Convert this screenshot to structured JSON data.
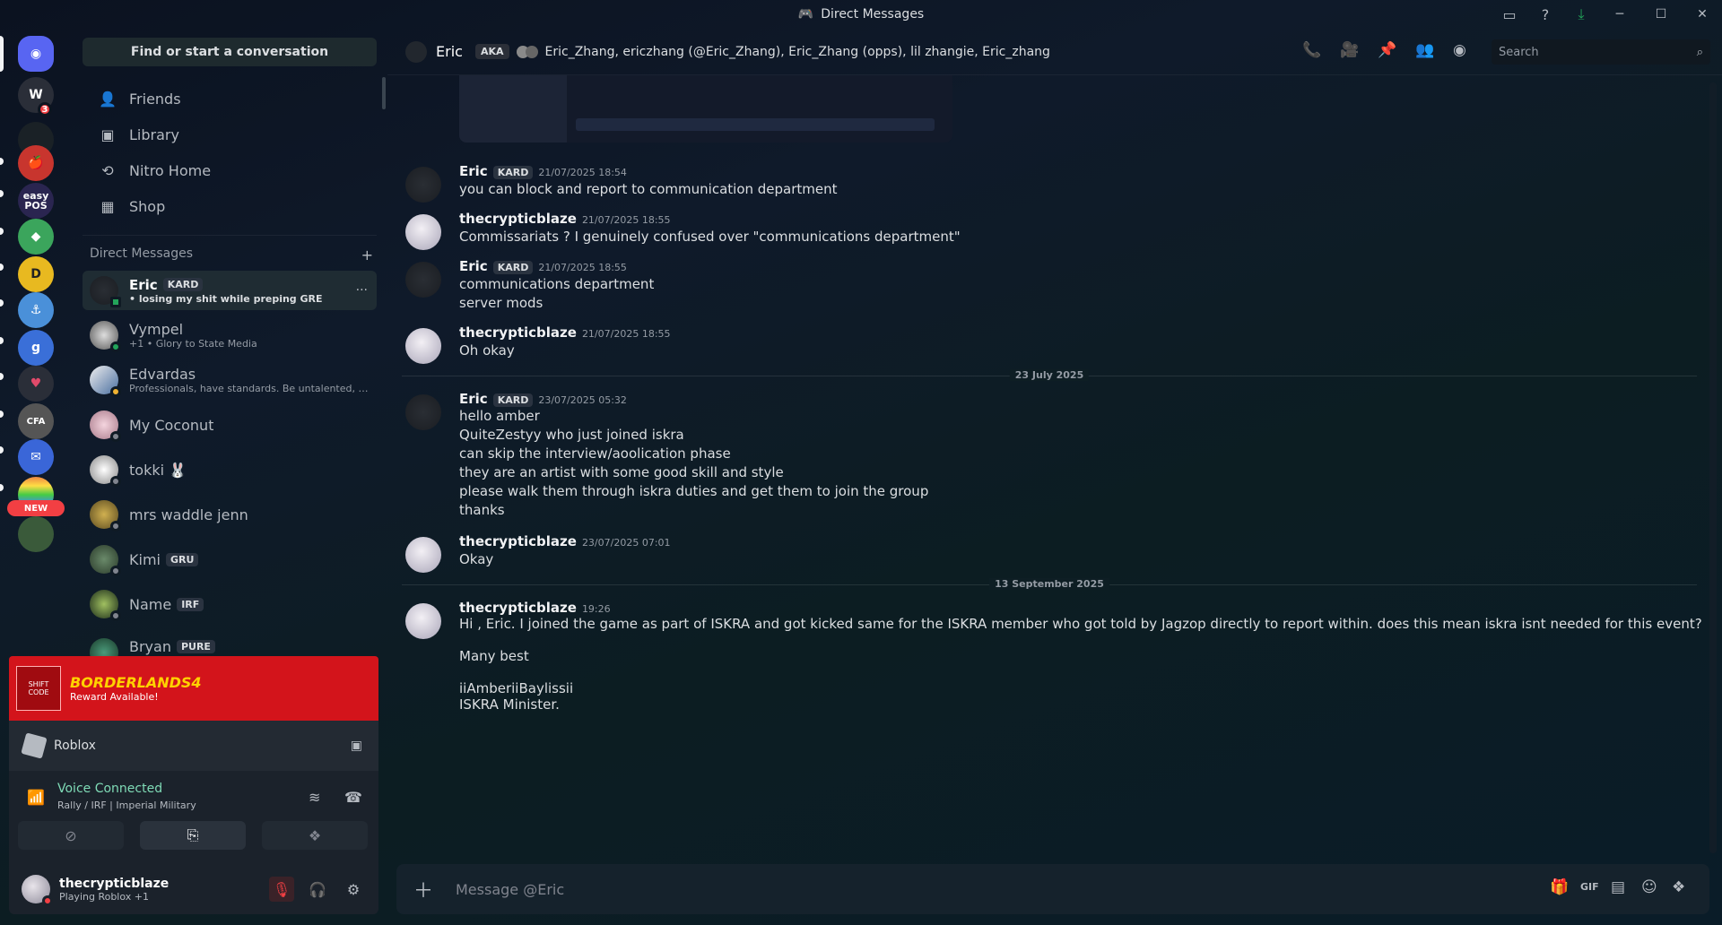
{
  "window": {
    "title": "Direct Messages"
  },
  "sidebar": {
    "find_label": "Find or start a conversation",
    "nav": [
      {
        "label": "Friends",
        "icon": "friends-icon"
      },
      {
        "label": "Library",
        "icon": "library-icon"
      },
      {
        "label": "Nitro Home",
        "icon": "nitro-icon"
      },
      {
        "label": "Shop",
        "icon": "shop-icon"
      }
    ],
    "dm_header": "Direct Messages",
    "dms": [
      {
        "name": "Eric",
        "tag": "KARD",
        "sub": "• losing my shit while preping GRE"
      },
      {
        "name": "Vympel",
        "tag": "",
        "sub": "+1 • Glory to State Media"
      },
      {
        "name": "Edvardas",
        "tag": "",
        "sub": "Professionals, have standards. Be untalented, be l..."
      },
      {
        "name": "My Coconut",
        "tag": "",
        "sub": ""
      },
      {
        "name": "tokki 🐰",
        "tag": "",
        "sub": ""
      },
      {
        "name": "mrs waddle jenn",
        "tag": "",
        "sub": ""
      },
      {
        "name": "Kimi",
        "tag": "GRU",
        "sub": ""
      },
      {
        "name": "Name",
        "tag": "IRF",
        "sub": ""
      },
      {
        "name": "Bryan",
        "tag": "PURE",
        "sub": ""
      }
    ],
    "promo": {
      "title": "BORDERLANDS4",
      "sub": "Reward Available!",
      "logo_text": "SHIFT CODE"
    },
    "activity": {
      "game": "Roblox"
    },
    "voice": {
      "title": "Voice Connected",
      "sub": "Rally / IRF | Imperial Military"
    },
    "user": {
      "name": "thecrypticblaze",
      "status": "Playing Roblox +1"
    }
  },
  "rail": {
    "badge_count": "3",
    "new_label": "NEW",
    "pos_label": "easy POS"
  },
  "chat": {
    "header": {
      "name": "Eric",
      "aka": "AKA",
      "aliases": "Eric_Zhang, ericzhang (@Eric_Zhang), Eric_Zhang (opps), lil zhangie, Eric_zhang",
      "search_placeholder": "Search"
    },
    "messages": [
      {
        "author": "Eric",
        "tag": "KARD",
        "ts": "21/07/2025 18:54",
        "lines": [
          "you can block and report to communication department"
        ]
      },
      {
        "author": "thecrypticblaze",
        "tag": "",
        "ts": "21/07/2025 18:55",
        "lines": [
          "Commissariats ?  I genuinely confused over \"communications department\""
        ]
      },
      {
        "author": "Eric",
        "tag": "KARD",
        "ts": "21/07/2025 18:55",
        "lines": [
          "communications department",
          "server mods"
        ]
      },
      {
        "author": "thecrypticblaze",
        "tag": "",
        "ts": "21/07/2025 18:55",
        "lines": [
          "Oh okay"
        ]
      },
      {
        "author": "Eric",
        "tag": "KARD",
        "ts": "23/07/2025 05:32",
        "lines": [
          "hello amber",
          "QuiteZestyy who just joined iskra",
          "can skip the interview/aoolication phase",
          "they are an artist with some good skill and style",
          "please walk them through iskra duties and get them to join the group",
          "thanks"
        ]
      },
      {
        "author": "thecrypticblaze",
        "tag": "",
        "ts": "23/07/2025 07:01",
        "lines": [
          "Okay"
        ]
      },
      {
        "author": "thecrypticblaze",
        "tag": "",
        "ts": "19:26",
        "lines": [
          "Hi , Eric. I joined the game as part of ISKRA and got kicked same for the ISKRA member who got told by Jagzop directly to report within. does this mean iskra isnt needed for this event?",
          "",
          "Many best",
          "",
          "iiAmberiiBaylissii",
          "ISKRA Minister."
        ]
      }
    ],
    "dividers": [
      "23 July 2025",
      "13 September 2025"
    ],
    "composer_placeholder": "Message @Eric"
  },
  "colors": {
    "accent": "#5865f2",
    "online": "#23a55a",
    "voice_green": "#7fdbb6",
    "danger": "#f23f43",
    "promo_red": "#d3141b"
  }
}
